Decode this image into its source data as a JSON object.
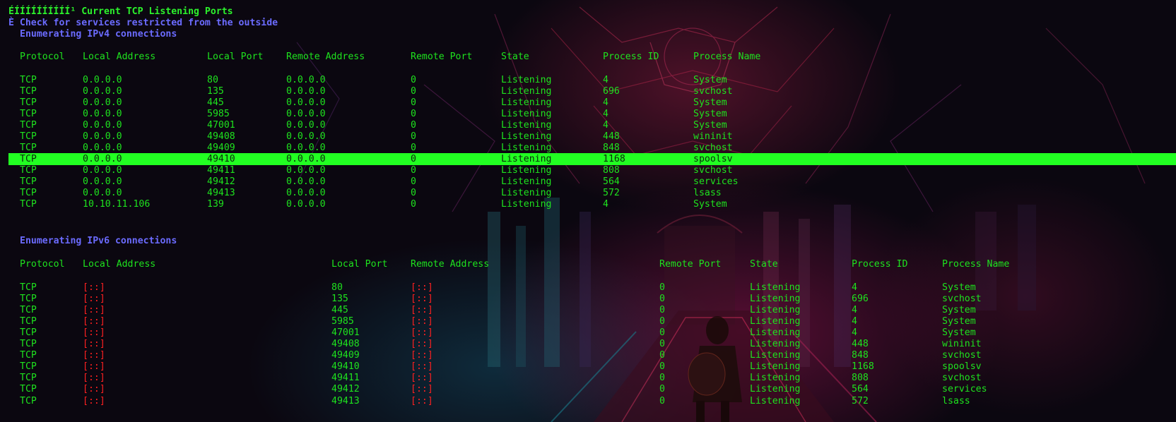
{
  "header": {
    "title_line": "ÉÍÍÍÍÍÍÍÍÍÍ¹ Current TCP Listening Ports",
    "check_line": "È Check for services restricted from the outside",
    "ipv4_heading": "Enumerating IPv4 connections",
    "ipv6_heading": "Enumerating IPv6 connections"
  },
  "ipv4": {
    "columns": [
      "Protocol",
      "Local Address",
      "Local Port",
      "Remote Address",
      "Remote Port",
      "State",
      "Process ID",
      "Process Name"
    ],
    "rows": [
      [
        "TCP",
        "0.0.0.0",
        "80",
        "0.0.0.0",
        "0",
        "Listening",
        "4",
        "System"
      ],
      [
        "TCP",
        "0.0.0.0",
        "135",
        "0.0.0.0",
        "0",
        "Listening",
        "696",
        "svchost"
      ],
      [
        "TCP",
        "0.0.0.0",
        "445",
        "0.0.0.0",
        "0",
        "Listening",
        "4",
        "System"
      ],
      [
        "TCP",
        "0.0.0.0",
        "5985",
        "0.0.0.0",
        "0",
        "Listening",
        "4",
        "System"
      ],
      [
        "TCP",
        "0.0.0.0",
        "47001",
        "0.0.0.0",
        "0",
        "Listening",
        "4",
        "System"
      ],
      [
        "TCP",
        "0.0.0.0",
        "49408",
        "0.0.0.0",
        "0",
        "Listening",
        "448",
        "wininit"
      ],
      [
        "TCP",
        "0.0.0.0",
        "49409",
        "0.0.0.0",
        "0",
        "Listening",
        "848",
        "svchost"
      ],
      [
        "TCP",
        "0.0.0.0",
        "49410",
        "0.0.0.0",
        "0",
        "Listening",
        "1168",
        "spoolsv"
      ],
      [
        "TCP",
        "0.0.0.0",
        "49411",
        "0.0.0.0",
        "0",
        "Listening",
        "808",
        "svchost"
      ],
      [
        "TCP",
        "0.0.0.0",
        "49412",
        "0.0.0.0",
        "0",
        "Listening",
        "564",
        "services"
      ],
      [
        "TCP",
        "0.0.0.0",
        "49413",
        "0.0.0.0",
        "0",
        "Listening",
        "572",
        "lsass"
      ],
      [
        "TCP",
        "10.10.11.106",
        "139",
        "0.0.0.0",
        "0",
        "Listening",
        "4",
        "System"
      ]
    ],
    "highlighted_row": 7
  },
  "ipv6": {
    "columns": [
      "Protocol",
      "Local Address",
      "Local Port",
      "Remote Address",
      "Remote Port",
      "State",
      "Process ID",
      "Process Name"
    ],
    "rows": [
      [
        "TCP",
        "[::]",
        "80",
        "[::]",
        "0",
        "Listening",
        "4",
        "System"
      ],
      [
        "TCP",
        "[::]",
        "135",
        "[::]",
        "0",
        "Listening",
        "696",
        "svchost"
      ],
      [
        "TCP",
        "[::]",
        "445",
        "[::]",
        "0",
        "Listening",
        "4",
        "System"
      ],
      [
        "TCP",
        "[::]",
        "5985",
        "[::]",
        "0",
        "Listening",
        "4",
        "System"
      ],
      [
        "TCP",
        "[::]",
        "47001",
        "[::]",
        "0",
        "Listening",
        "4",
        "System"
      ],
      [
        "TCP",
        "[::]",
        "49408",
        "[::]",
        "0",
        "Listening",
        "448",
        "wininit"
      ],
      [
        "TCP",
        "[::]",
        "49409",
        "[::]",
        "0",
        "Listening",
        "848",
        "svchost"
      ],
      [
        "TCP",
        "[::]",
        "49410",
        "[::]",
        "0",
        "Listening",
        "1168",
        "spoolsv"
      ],
      [
        "TCP",
        "[::]",
        "49411",
        "[::]",
        "0",
        "Listening",
        "808",
        "svchost"
      ],
      [
        "TCP",
        "[::]",
        "49412",
        "[::]",
        "0",
        "Listening",
        "564",
        "services"
      ],
      [
        "TCP",
        "[::]",
        "49413",
        "[::]",
        "0",
        "Listening",
        "572",
        "lsass"
      ]
    ]
  },
  "colors": {
    "text_green": "#1ee31e",
    "heading_blue": "#6b6bff",
    "ipv6_address_red": "#ff2020",
    "highlight_bg": "#22ff22"
  }
}
